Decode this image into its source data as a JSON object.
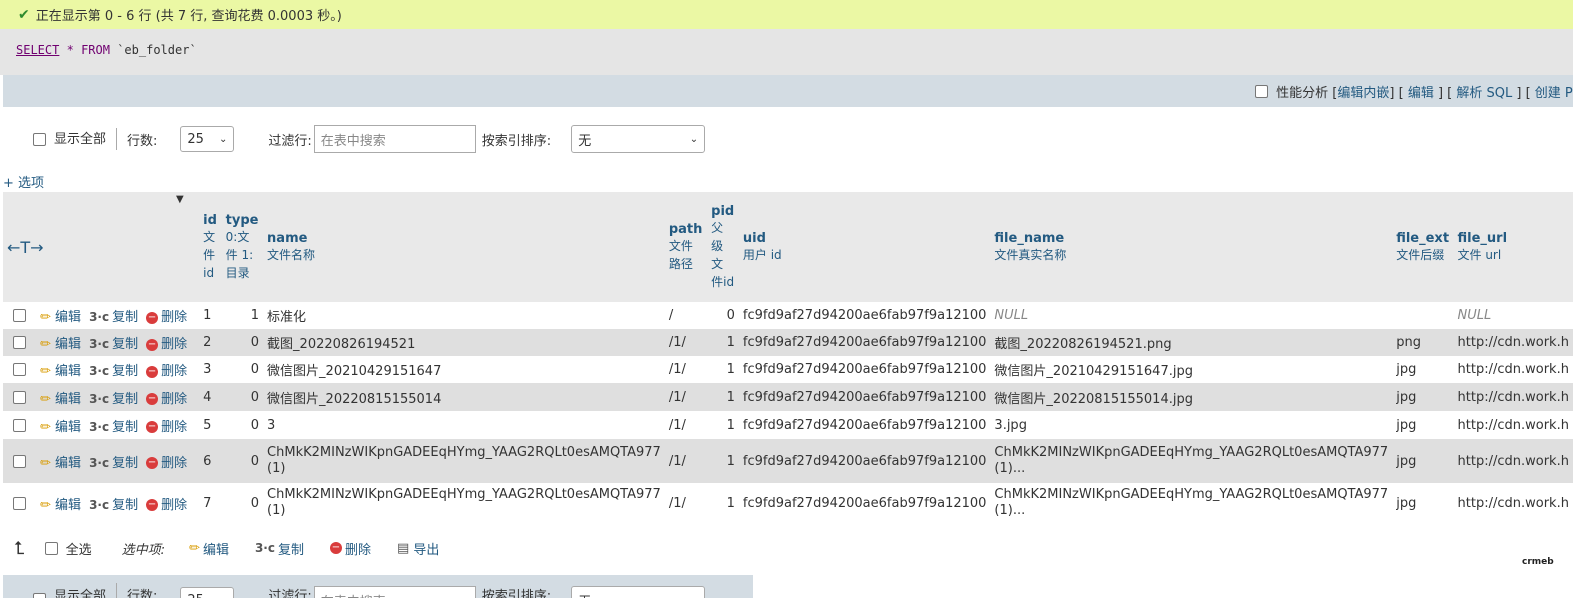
{
  "status": {
    "message": "正在显示第 0 - 6 行 (共 7 行, 查询花费 0.0003 秒。)"
  },
  "sql": {
    "select": "SELECT",
    "star": "*",
    "from": "FROM",
    "table": "`eb_folder`"
  },
  "toolbar": {
    "profiling": "性能分析",
    "edit_inline": "编辑内嵌",
    "edit": "编辑",
    "explain": "解析 SQL",
    "create": "创建 PH"
  },
  "nav": {
    "show_all": "显示全部",
    "rows_label": "行数:",
    "rows_value": "25",
    "filter_label": "过滤行:",
    "filter_placeholder": "在表中搜索",
    "sort_label": "按索引排序:",
    "sort_value": "无"
  },
  "options_link": "+ 选项",
  "columns": [
    {
      "name": "id",
      "comment": "文件id"
    },
    {
      "name": "type",
      "comment": "0:文件 1:目录"
    },
    {
      "name": "name",
      "comment": "文件名称"
    },
    {
      "name": "path",
      "comment": "文件路径"
    },
    {
      "name": "pid",
      "comment": "父级文件id"
    },
    {
      "name": "uid",
      "comment": "用户 id"
    },
    {
      "name": "file_name",
      "comment": "文件真实名称"
    },
    {
      "name": "file_ext",
      "comment": "文件后缀"
    },
    {
      "name": "file_url",
      "comment": "文件 url"
    }
  ],
  "row_actions": {
    "edit": "编辑",
    "copy": "复制",
    "delete": "删除"
  },
  "rows": [
    {
      "id": "1",
      "type": "1",
      "name": "标准化",
      "path": "/",
      "pid": "0",
      "uid": "fc9fd9af27d94200ae6fab97f9a12100",
      "file_name": "NULL",
      "file_ext": "",
      "file_url": "NULL"
    },
    {
      "id": "2",
      "type": "0",
      "name": "截图_20220826194521",
      "path": "/1/",
      "pid": "1",
      "uid": "fc9fd9af27d94200ae6fab97f9a12100",
      "file_name": "截图_20220826194521.png",
      "file_ext": "png",
      "file_url": "http://cdn.work.h"
    },
    {
      "id": "3",
      "type": "0",
      "name": "微信图片_20210429151647",
      "path": "/1/",
      "pid": "1",
      "uid": "fc9fd9af27d94200ae6fab97f9a12100",
      "file_name": "微信图片_20210429151647.jpg",
      "file_ext": "jpg",
      "file_url": "http://cdn.work.h"
    },
    {
      "id": "4",
      "type": "0",
      "name": "微信图片_20220815155014",
      "path": "/1/",
      "pid": "1",
      "uid": "fc9fd9af27d94200ae6fab97f9a12100",
      "file_name": "微信图片_20220815155014.jpg",
      "file_ext": "jpg",
      "file_url": "http://cdn.work.h"
    },
    {
      "id": "5",
      "type": "0",
      "name": "3",
      "path": "/1/",
      "pid": "1",
      "uid": "fc9fd9af27d94200ae6fab97f9a12100",
      "file_name": "3.jpg",
      "file_ext": "jpg",
      "file_url": "http://cdn.work.h"
    },
    {
      "id": "6",
      "type": "0",
      "name": "ChMkK2MINzWIKpnGADEEqHYmg_YAAG2RQLt0esAMQTA977 (1)",
      "path": "/1/",
      "pid": "1",
      "uid": "fc9fd9af27d94200ae6fab97f9a12100",
      "file_name": "ChMkK2MINzWIKpnGADEEqHYmg_YAAG2RQLt0esAMQTA977 (1)...",
      "file_ext": "jpg",
      "file_url": "http://cdn.work.h"
    },
    {
      "id": "7",
      "type": "0",
      "name": "ChMkK2MINzWIKpnGADEEqHYmg_YAAG2RQLt0esAMQTA977 (1)",
      "path": "/1/",
      "pid": "1",
      "uid": "fc9fd9af27d94200ae6fab97f9a12100",
      "file_name": "ChMkK2MINzWIKpnGADEEqHYmg_YAAG2RQLt0esAMQTA977 (1)...",
      "file_ext": "jpg",
      "file_url": "http://cdn.work.h"
    }
  ],
  "bulk": {
    "select_all": "全选",
    "selected_label": "选中项:",
    "edit": "编辑",
    "copy": "复制",
    "delete": "删除",
    "export": "导出"
  },
  "logo_text": "crmeb"
}
